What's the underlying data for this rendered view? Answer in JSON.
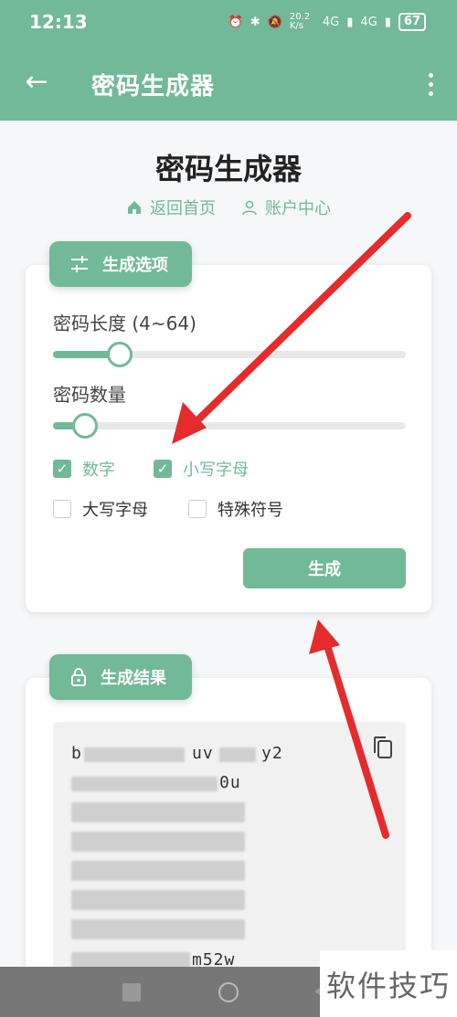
{
  "status_bar": {
    "time": "12:13",
    "speed": "20.2 K/s",
    "net1": "4G",
    "net2": "4G",
    "battery": "67"
  },
  "app_bar": {
    "title": "密码生成器"
  },
  "page": {
    "title": "密码生成器",
    "links": [
      {
        "label": "返回首页",
        "icon": "home-icon"
      },
      {
        "label": "账户中心",
        "icon": "user-icon"
      }
    ]
  },
  "options": {
    "tab_label": "生成选项",
    "length_label": "密码长度 (4~64)",
    "length_level": 0.19,
    "count_label": "密码数量",
    "count_level": 0.09,
    "checkboxes": [
      {
        "label": "数字",
        "checked": true
      },
      {
        "label": "小写字母",
        "checked": true
      },
      {
        "label": "大写字母",
        "checked": false
      },
      {
        "label": "特殊符号",
        "checked": false
      }
    ],
    "generate_label": "生成"
  },
  "result": {
    "tab_label": "生成结果",
    "visible_fragments": [
      "b",
      "uv",
      "y2",
      "0u",
      "m52w"
    ]
  },
  "accent_color": "#72b997",
  "watermark": "软件技巧"
}
